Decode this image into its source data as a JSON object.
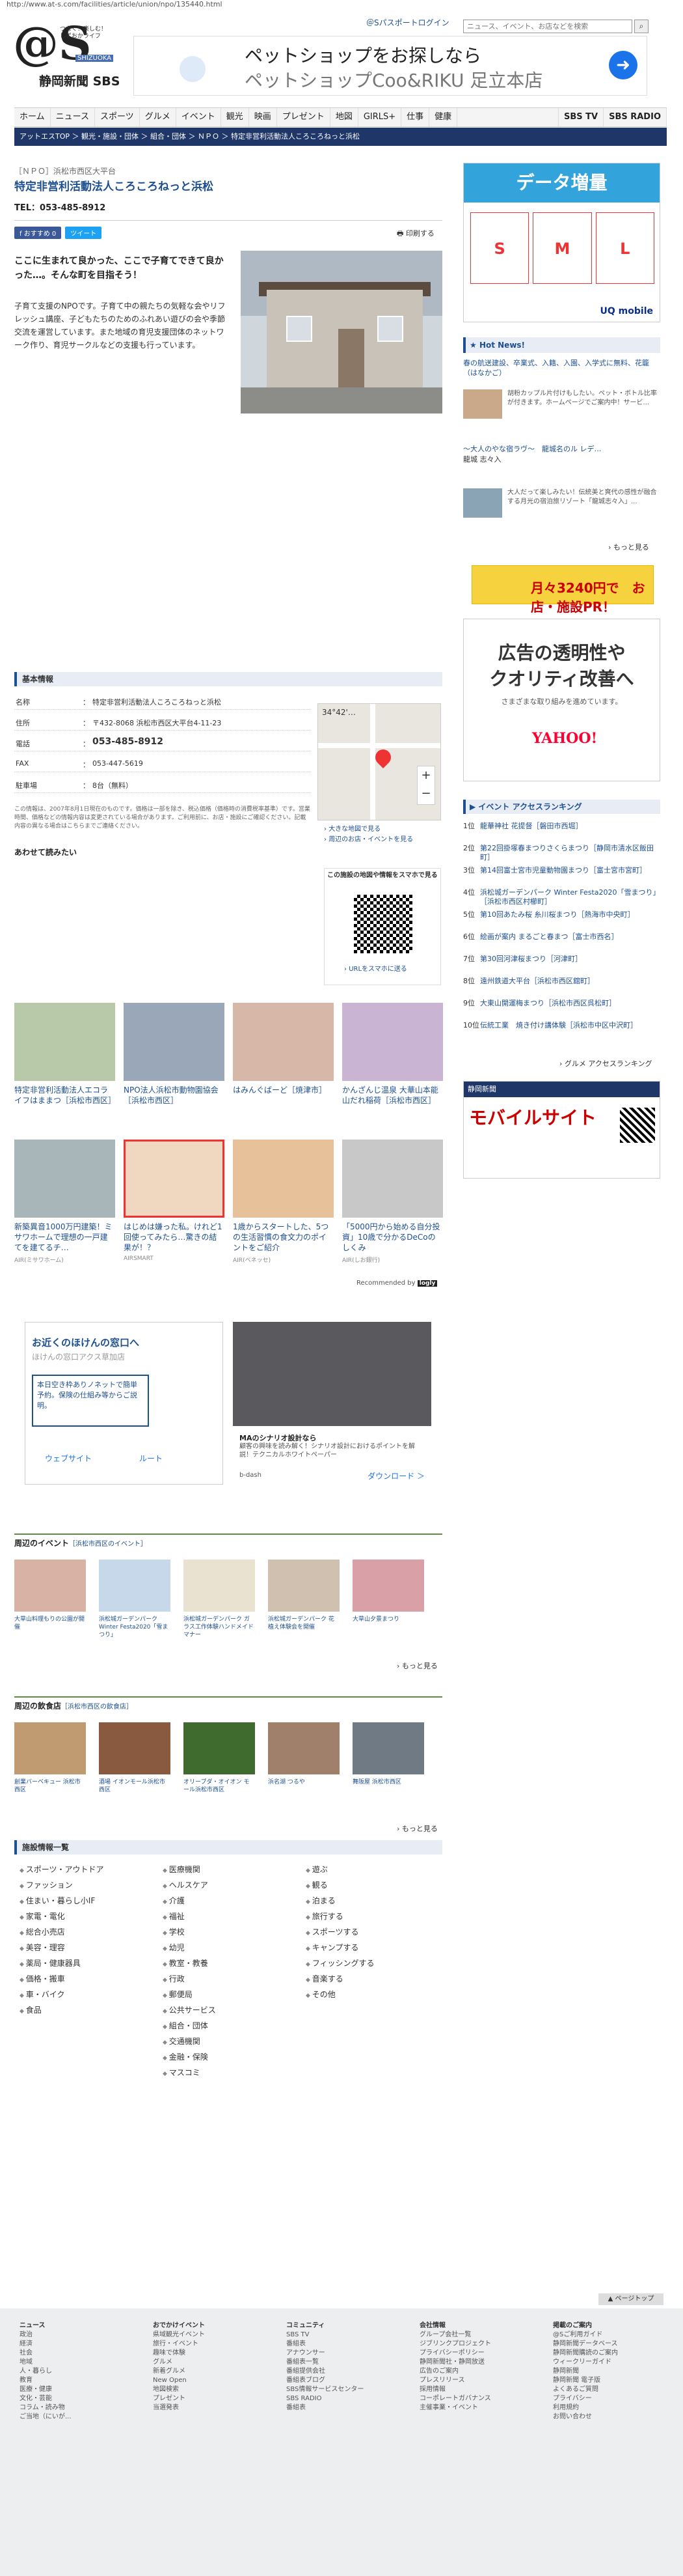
{
  "url": "http://www.at-s.com/facilities/article/union/npo/135440.html",
  "logo": {
    "at": "@S",
    "tagline": [
      "つなぐ！楽しむ！",
      "しずおかライフ"
    ],
    "shizuoka": "SHIZUOKA",
    "name": "静岡新聞 SBS"
  },
  "top_ad": {
    "line1": "ペットショップをお探しなら",
    "line2": "ペットショップCoo&RIKU 足立本店"
  },
  "passport": "＠Sパスポートログイン",
  "search_placeholder": "ニュース、イベント、お店などを検索",
  "nav": [
    "ホーム",
    "ニュース",
    "スポーツ",
    "グルメ",
    "イベント",
    "観光",
    "映画",
    "プレゼント",
    "地図",
    "GIRLS+",
    "仕事",
    "健康",
    "SBS TV",
    "SBS RADIO"
  ],
  "breadcrumb": "アットエスTOP ＞ 観光・施設・団体 ＞ 組合・団体 ＞ ＮＰＯ ＞ 特定非営利活動法人ころころねっと浜松",
  "article": {
    "cat": "［ＮＰＯ］浜松市西区大平台",
    "title": "特定非営利活動法人ころころねっと浜松",
    "tel": "TEL：053-485-8912",
    "fb": "f おすすめ 0",
    "tw": "ツイート",
    "print": "印刷する",
    "lead": "ここに生まれて良かった、ここで子育てできて良かった…。そんな町を目指そう！",
    "body": "子育て支援のNPOです。子育て中の親たちの気軽な会やリフレッシュ講座、子どもたちのためのふれあい遊びの会や季節交流を運営しています。また地域の育児支援団体のネットワーク作り、育児サークルなどの支援も行っています。"
  },
  "basic": {
    "header": "基本情報",
    "rows": [
      {
        "k": "名称",
        "v": "特定非営利活動法人ころころねっと浜松"
      },
      {
        "k": "住所",
        "v": "〒432-8068 浜松市西区大平台4-11-23"
      },
      {
        "k": "電話",
        "v": "053-485-8912"
      },
      {
        "k": "FAX",
        "v": "053-447-5619"
      },
      {
        "k": "駐車場",
        "v": "8台（無料）"
      }
    ],
    "note": "この情報は、2007年8月1日現在のものです。価格は一部を除き、税込価格（価格時の消費税率基準）です。営業時間、価格などの情報内容は変更されている場合があります。ご利用前に、お店・施設にご確認ください。記載内容の異なる場合はこちらまでご連絡ください。",
    "share": "あわせて読みたい"
  },
  "map": {
    "label": "34°42'…",
    "big": "大きな地図で見る",
    "around": "周辺のお店・イベントを見る"
  },
  "qr": {
    "title": "この施設の地図や情報をスマホで見る",
    "link": "URLをスマホに送る"
  },
  "sidead": {
    "head": "データ増量",
    "plans": [
      "S",
      "M",
      "L"
    ],
    "brand": "UQ mobile"
  },
  "hotnews": {
    "header": "Hot News!",
    "n1": "春の航送建設、卒業式、入籍、入園、入学式に無料、花籠（はなかご）",
    "n1txt": "胡粉カップル片付けもしたい。ペット・ボトル比率が付きます。ホームページでご案内中！サービ...",
    "n2": "～大人のやな宿ラヴ～　龍城名のル レデ…",
    "n2sub": "龍城 志々入",
    "n2txt": "大人だって楽しみたい！伝統美と爽代の感性が融合する月光の宿泊旅リゾート「龍城志々入」...",
    "more": "もっと見る"
  },
  "ad2": "月々3240円で　お店・施設PR！",
  "ad3": {
    "t1": "広告の透明性や",
    "t2": "クオリティ改善へ",
    "t3": "さまざまな取り組みを進めています。",
    "brand": "YAHOO!"
  },
  "ranking": {
    "header": "イベント アクセスランキング",
    "items": [
      {
        "n": "1位",
        "v": "龍華神社 花提督［磐田市西堀］"
      },
      {
        "n": "2位",
        "v": "第22回掛塚春まつりさくらまつり［静岡市清水区飯田町］"
      },
      {
        "n": "3位",
        "v": "第14回富士宮市児童動物園まつり［富士宮市宮町］"
      },
      {
        "n": "4位",
        "v": "浜松城ガーデンパーク Winter Festa2020「雪まつり」［浜松市西区村櫛町］"
      },
      {
        "n": "5位",
        "v": "第10回あたみ桜 糸川桜まつり［熱海市中央町］"
      },
      {
        "n": "6位",
        "v": "絵画が案内 まるごと春まつ［富士市西名］"
      },
      {
        "n": "7位",
        "v": "第30回河津桜まつり［河津町］"
      },
      {
        "n": "8位",
        "v": "遠州鉄道大平台［浜松市西区舘町］"
      },
      {
        "n": "9位",
        "v": "大東山開運梅まつり［浜松市西区呉松町］"
      },
      {
        "n": "10位",
        "v": "伝統工業　焼き付け講体験［浜松市中区中沢町］"
      }
    ],
    "more": "グルメ アクセスランキング"
  },
  "mobile_ad": {
    "head": "静岡新聞",
    "t": "モバイルサイト"
  },
  "cards": [
    {
      "t": "特定非営利活動法人エコライフはままつ［浜松市西区］",
      "sm": ""
    },
    {
      "t": "NPO法人浜松市動物園協会［浜松市西区］",
      "sm": ""
    },
    {
      "t": "はみんぐばーど［焼津市］",
      "sm": ""
    },
    {
      "t": "かんざんじ温泉 大華山本能山だれ稲荷［浜松市西区］",
      "sm": ""
    },
    {
      "t": "新築異音1000万円建築！ミサワホームで理想の一戸建てを建てるチ…",
      "sm": "AIR(ミサワホーム)"
    },
    {
      "t": "はじめは嫌った私。けれど1回使ってみたら…驚きの結果が！？",
      "sm": "AIRSMART"
    },
    {
      "t": "1歳からスタートした、5つの生活習慣の食文力のポイントをご紹介",
      "sm": "AIR(ベネッセ)"
    },
    {
      "t": "「5000円から始める自分投資」10歳で分かるDeCoのしくみ",
      "sm": "AIR(しお銀行)"
    }
  ],
  "rec": "Recommended by",
  "rec_brand": "logly",
  "ad5": {
    "t1": "お近くのほけんの窓口へ",
    "t2": "ほけんの窓口アクス草加店",
    "box": "本日空き枠ありノネットで簡単予約。保険の仕組み等からご説明。",
    "b1": "ウェブサイト",
    "b2": "ルート"
  },
  "ad6": {
    "t1": "MAのシナリオ設計なら",
    "t2": "顧客の興味を読み解く！シナリオ設計におけるポイントを解説！テクニカルホワイトペーパー",
    "t3": "b-dash",
    "t4": "ダウンロード ＞"
  },
  "events": {
    "header": "周辺のイベント",
    "sub": "［浜松市西区のイベント］",
    "items": [
      {
        "t": "大草山料理もりの公園が開催"
      },
      {
        "t": "浜松城ガーデンパーク Winter Festa2020「雪まつり」"
      },
      {
        "t": "浜松城ガーデンパーク ガラス工作体験ハンドメイドマナー"
      },
      {
        "t": "浜松城ガーデンパーク 花植え体験会を開催"
      },
      {
        "t": "大草山夕景まつり"
      }
    ],
    "more": "もっと見る"
  },
  "gourmet": {
    "header": "周辺の飲食店",
    "sub": "［浜松市西区の飲食店］",
    "items": [
      {
        "t": "創業バーベキュー 浜松市西区"
      },
      {
        "t": "酒場 イオンモール浜松市西区"
      },
      {
        "t": "オリーブダ・オイオン モール浜松市西区"
      },
      {
        "t": "浜名湖 つるや"
      },
      {
        "t": "舞阪屋 浜松市西区"
      }
    ],
    "more": "もっと見る"
  },
  "directory": {
    "header": "施設情報一覧",
    "c1": [
      "スポーツ・アウトドア",
      "ファッション",
      "住まい・暮らし小IF",
      "家電・電化",
      "総合小売店",
      "美容・理容",
      "薬局・健康器具",
      "価格・搬車",
      "車・バイク",
      "食品"
    ],
    "c2": [
      "医療機関",
      "ヘルスケア",
      "介護",
      "福祉",
      "学校",
      "幼児",
      "教室・教養",
      "行政",
      "郵便局",
      "公共サービス",
      "組合・団体",
      "交通機関",
      "金融・保険",
      "マスコミ"
    ],
    "c3": [
      "遊ぶ",
      "観る",
      "泊まる",
      "旅行する",
      "スポーツする",
      "キャンプする",
      "フィッシングする",
      "音楽する",
      "その他"
    ]
  },
  "pagetop": "▲ ページトップ",
  "footer": [
    {
      "h": "ニュース",
      "items": [
        "政治",
        "経済",
        "社会",
        "地域",
        "人・暮らし",
        "教育",
        "医療・健康",
        "文化・芸能",
        "コラム・読み物",
        "ご当地（にいが..."
      ]
    },
    {
      "h": "おでかけイベント",
      "items": [
        "県域観光イベント",
        "旅行・イベント",
        "趣味で体験",
        "",
        "グルメ",
        "新着グルメ",
        "New Open",
        "",
        "地図検索",
        "",
        "プレゼント",
        "当選発表"
      ]
    },
    {
      "h": "コミュニティ",
      "items": [
        "SBS TV",
        "番組表",
        "アナウンサー",
        "番組表一覧",
        "番組提供会社",
        "番組表ブログ",
        "SBS情報サービスセンター",
        "",
        "SBS RADIO",
        "番組表"
      ]
    },
    {
      "h": "会社情報",
      "items": [
        "グループ会社一覧",
        "ジブリンクプロジェクト",
        "プライバシーポリシー",
        "静岡新聞社・静岡放送",
        "広告のご案内",
        "プレスリリース",
        "採用情報",
        "コーポレートガバナンス",
        "",
        "主催事業・イベント"
      ]
    },
    {
      "h": "掲載のご案内",
      "items": [
        "@Sご利用ガイド",
        "静岡新聞データベース",
        "静岡新聞購読のご案内",
        "ウィークリーガイド",
        "静岡新聞",
        "静岡新聞 電子版",
        "よくあるご質問",
        "プライバシー",
        "利用規約",
        "お問い合わせ"
      ]
    }
  ]
}
